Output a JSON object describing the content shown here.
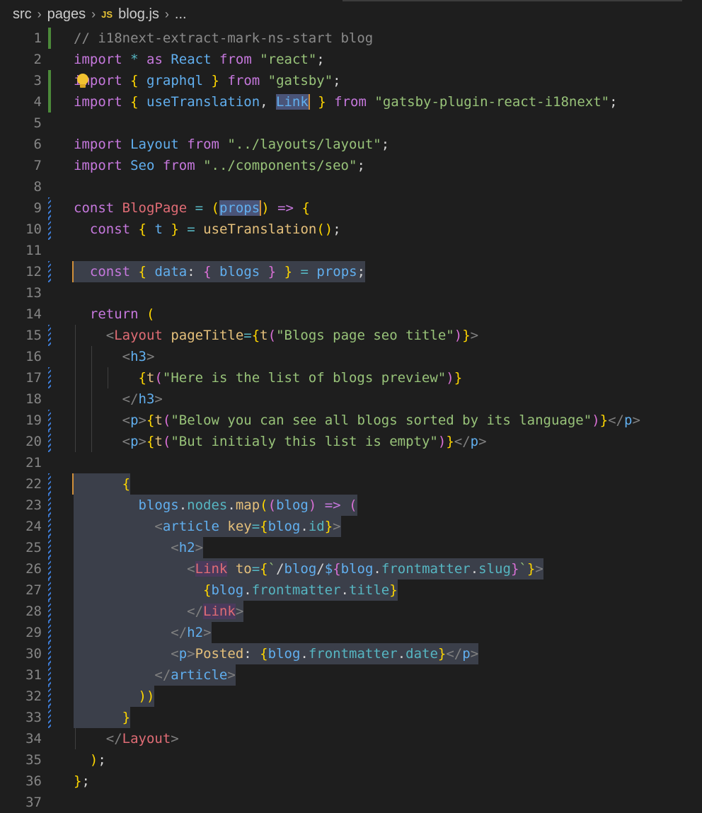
{
  "breadcrumb": {
    "items": [
      "src",
      "pages",
      "blog.js",
      "..."
    ],
    "js_badge": "JS"
  },
  "editor": {
    "language": "javascript",
    "highlighted_word": "Link",
    "lines": [
      {
        "n": "1",
        "text": "// i18next-extract-mark-ns-start blog"
      },
      {
        "n": "2",
        "text": "import * as React from \"react\";"
      },
      {
        "n": "3",
        "text": "import { graphql } from \"gatsby\";"
      },
      {
        "n": "4",
        "text": "import { useTranslation, Link } from \"gatsby-plugin-react-i18next\";"
      },
      {
        "n": "5",
        "text": ""
      },
      {
        "n": "6",
        "text": "import Layout from \"../layouts/layout\";"
      },
      {
        "n": "7",
        "text": "import Seo from \"../components/seo\";"
      },
      {
        "n": "8",
        "text": ""
      },
      {
        "n": "9",
        "text": "const BlogPage = (props) => {"
      },
      {
        "n": "10",
        "text": "  const { t } = useTranslation();"
      },
      {
        "n": "11",
        "text": ""
      },
      {
        "n": "12",
        "text": "  const { data: { blogs } } = props;"
      },
      {
        "n": "13",
        "text": ""
      },
      {
        "n": "14",
        "text": "  return ("
      },
      {
        "n": "15",
        "text": "    <Layout pageTitle={t(\"Blogs page seo title\")}>"
      },
      {
        "n": "16",
        "text": "      <h3>"
      },
      {
        "n": "17",
        "text": "        {t(\"Here is the list of blogs preview\")}"
      },
      {
        "n": "18",
        "text": "      </h3>"
      },
      {
        "n": "19",
        "text": "      <p>{t(\"Below you can see all blogs sorted by its language\")}</p>"
      },
      {
        "n": "20",
        "text": "      <p>{t(\"But initialy this list is empty\")}</p>"
      },
      {
        "n": "21",
        "text": ""
      },
      {
        "n": "22",
        "text": "      {"
      },
      {
        "n": "23",
        "text": "        blogs.nodes.map((blog) => ("
      },
      {
        "n": "24",
        "text": "          <article key={blog.id}>"
      },
      {
        "n": "25",
        "text": "            <h2>"
      },
      {
        "n": "26",
        "text": "              <Link to={`/blog/${blog.frontmatter.slug}`}>"
      },
      {
        "n": "27",
        "text": "                {blog.frontmatter.title}"
      },
      {
        "n": "28",
        "text": "              </Link>"
      },
      {
        "n": "29",
        "text": "            </h2>"
      },
      {
        "n": "30",
        "text": "            <p>Posted: {blog.frontmatter.date}</p>"
      },
      {
        "n": "31",
        "text": "          </article>"
      },
      {
        "n": "32",
        "text": "        ))"
      },
      {
        "n": "33",
        "text": "      }"
      },
      {
        "n": "34",
        "text": "    </Layout>"
      },
      {
        "n": "35",
        "text": "  );"
      },
      {
        "n": "36",
        "text": "};"
      },
      {
        "n": "37",
        "text": ""
      }
    ]
  }
}
